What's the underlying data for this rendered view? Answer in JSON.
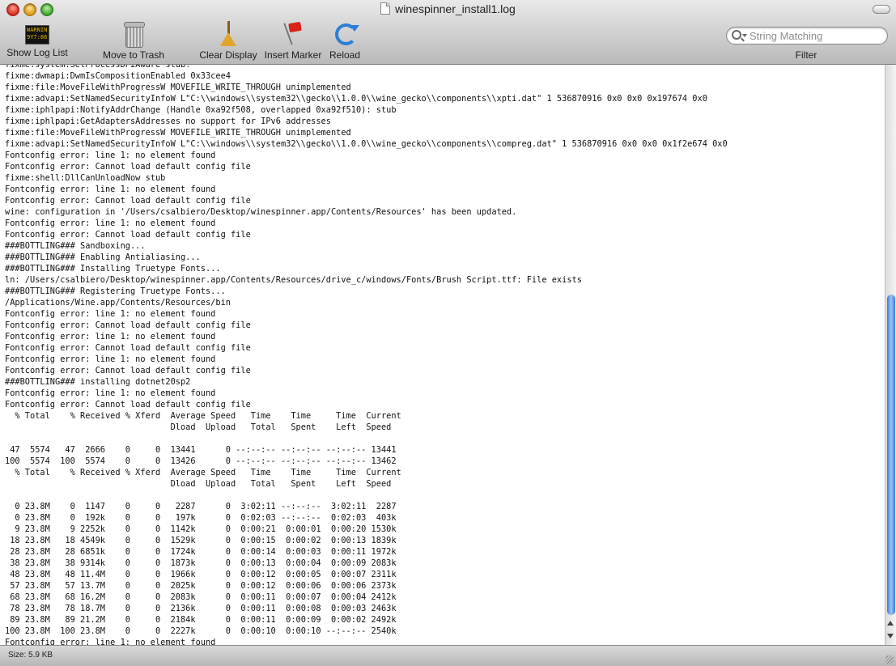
{
  "window": {
    "title": "winespinner_install1.log"
  },
  "toolbar": {
    "show_log_list": "Show Log List",
    "console_icon_text": "WARNIN\n9Y7:86",
    "move_to_trash": "Move to Trash",
    "clear_display": "Clear Display",
    "insert_marker": "Insert Marker",
    "reload": "Reload",
    "search_placeholder": "String Matching",
    "filter_label": "Filter"
  },
  "log": {
    "lines": [
      "fixme:system:SetProcessDPIAware stub!",
      "fixme:dwmapi:DwmIsCompositionEnabled 0x33cee4",
      "fixme:file:MoveFileWithProgressW MOVEFILE_WRITE_THROUGH unimplemented",
      "fixme:advapi:SetNamedSecurityInfoW L\"C:\\\\windows\\\\system32\\\\gecko\\\\1.0.0\\\\wine_gecko\\\\components\\\\xpti.dat\" 1 536870916 0x0 0x0 0x197674 0x0",
      "fixme:iphlpapi:NotifyAddrChange (Handle 0xa92f508, overlapped 0xa92f510): stub",
      "fixme:iphlpapi:GetAdaptersAddresses no support for IPv6 addresses",
      "fixme:file:MoveFileWithProgressW MOVEFILE_WRITE_THROUGH unimplemented",
      "fixme:advapi:SetNamedSecurityInfoW L\"C:\\\\windows\\\\system32\\\\gecko\\\\1.0.0\\\\wine_gecko\\\\components\\\\compreg.dat\" 1 536870916 0x0 0x0 0x1f2e674 0x0",
      "Fontconfig error: line 1: no element found",
      "Fontconfig error: Cannot load default config file",
      "fixme:shell:DllCanUnloadNow stub",
      "Fontconfig error: line 1: no element found",
      "Fontconfig error: Cannot load default config file",
      "wine: configuration in '/Users/csalbiero/Desktop/winespinner.app/Contents/Resources' has been updated.",
      "Fontconfig error: line 1: no element found",
      "Fontconfig error: Cannot load default config file",
      "###BOTTLING### Sandboxing...",
      "###BOTTLING### Enabling Antialiasing...",
      "###BOTTLING### Installing Truetype Fonts...",
      "ln: /Users/csalbiero/Desktop/winespinner.app/Contents/Resources/drive_c/windows/Fonts/Brush Script.ttf: File exists",
      "###BOTTLING### Registering Truetype Fonts...",
      "/Applications/Wine.app/Contents/Resources/bin",
      "Fontconfig error: line 1: no element found",
      "Fontconfig error: Cannot load default config file",
      "Fontconfig error: line 1: no element found",
      "Fontconfig error: Cannot load default config file",
      "Fontconfig error: line 1: no element found",
      "Fontconfig error: Cannot load default config file",
      "###BOTTLING### installing dotnet20sp2",
      "Fontconfig error: line 1: no element found",
      "Fontconfig error: Cannot load default config file",
      "  % Total    % Received % Xferd  Average Speed   Time    Time     Time  Current",
      "                                 Dload  Upload   Total   Spent    Left  Speed",
      "",
      " 47  5574   47  2666    0     0  13441      0 --:--:-- --:--:-- --:--:-- 13441",
      "100  5574  100  5574    0     0  13426      0 --:--:-- --:--:-- --:--:-- 13462",
      "  % Total    % Received % Xferd  Average Speed   Time    Time     Time  Current",
      "                                 Dload  Upload   Total   Spent    Left  Speed",
      "",
      "  0 23.8M    0  1147    0     0   2287      0  3:02:11 --:--:--  3:02:11  2287",
      "  0 23.8M    0  192k    0     0   197k      0  0:02:03 --:--:--  0:02:03  403k",
      "  9 23.8M    9 2252k    0     0  1142k      0  0:00:21  0:00:01  0:00:20 1530k",
      " 18 23.8M   18 4549k    0     0  1529k      0  0:00:15  0:00:02  0:00:13 1839k",
      " 28 23.8M   28 6851k    0     0  1724k      0  0:00:14  0:00:03  0:00:11 1972k",
      " 38 23.8M   38 9314k    0     0  1873k      0  0:00:13  0:00:04  0:00:09 2083k",
      " 48 23.8M   48 11.4M    0     0  1966k      0  0:00:12  0:00:05  0:00:07 2311k",
      " 57 23.8M   57 13.7M    0     0  2025k      0  0:00:12  0:00:06  0:00:06 2373k",
      " 68 23.8M   68 16.2M    0     0  2083k      0  0:00:11  0:00:07  0:00:04 2412k",
      " 78 23.8M   78 18.7M    0     0  2136k      0  0:00:11  0:00:08  0:00:03 2463k",
      " 89 23.8M   89 21.2M    0     0  2184k      0  0:00:11  0:00:09  0:00:02 2492k",
      "100 23.8M  100 23.8M    0     0  2227k      0  0:00:10  0:00:10 --:--:-- 2540k",
      "Fontconfig error: line 1: no element found"
    ]
  },
  "status": {
    "size": "Size: 5.9 KB"
  }
}
